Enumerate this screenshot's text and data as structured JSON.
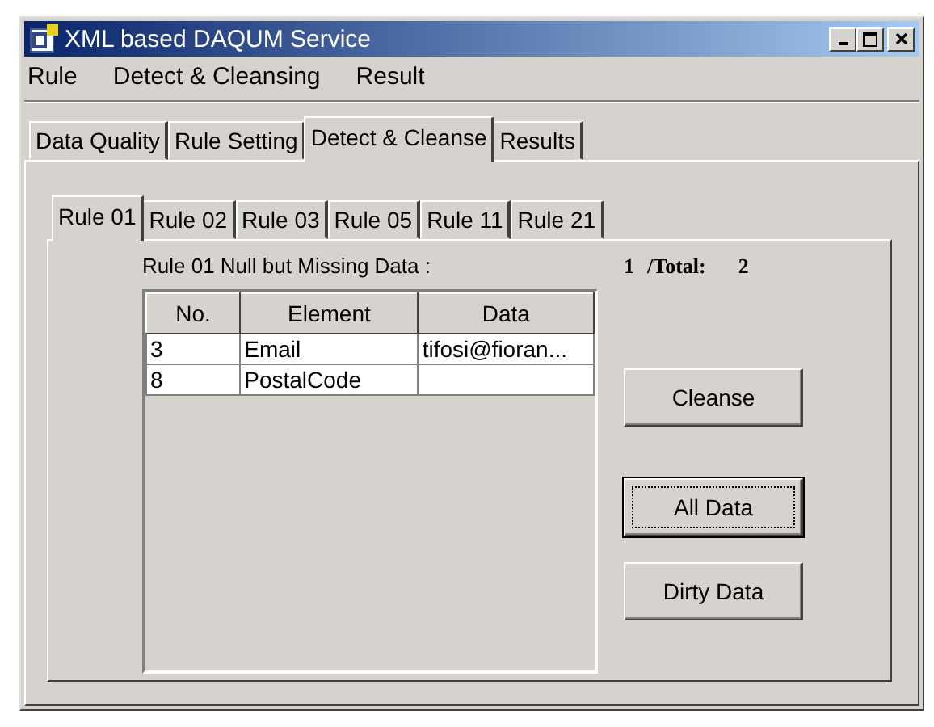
{
  "window": {
    "title": "XML based DAQUM Service"
  },
  "menu": [
    "Rule",
    "Detect & Cleansing",
    "Result"
  ],
  "tabs": [
    {
      "label": "Data Quality",
      "selected": false
    },
    {
      "label": "Rule Setting",
      "selected": false
    },
    {
      "label": "Detect & Cleanse",
      "selected": true
    },
    {
      "label": "Results",
      "selected": false
    }
  ],
  "rule_tabs": [
    {
      "label": "Rule 01",
      "selected": true
    },
    {
      "label": "Rule 02",
      "selected": false
    },
    {
      "label": "Rule 03",
      "selected": false
    },
    {
      "label": "Rule 05",
      "selected": false
    },
    {
      "label": "Rule 11",
      "selected": false
    },
    {
      "label": "Rule 21",
      "selected": false
    }
  ],
  "caption": "Rule 01 Null but Missing Data :",
  "counter": {
    "current": "1",
    "label": "/Total:",
    "total": "2"
  },
  "table": {
    "columns": [
      "No.",
      "Element",
      "Data"
    ],
    "rows": [
      [
        "3",
        "Email",
        "tifosi@fioran..."
      ],
      [
        "8",
        "PostalCode",
        ""
      ]
    ]
  },
  "buttons": [
    {
      "label": "Cleanse",
      "focused": false
    },
    {
      "label": "All Data",
      "focused": true
    },
    {
      "label": "Dirty Data",
      "focused": false
    }
  ]
}
